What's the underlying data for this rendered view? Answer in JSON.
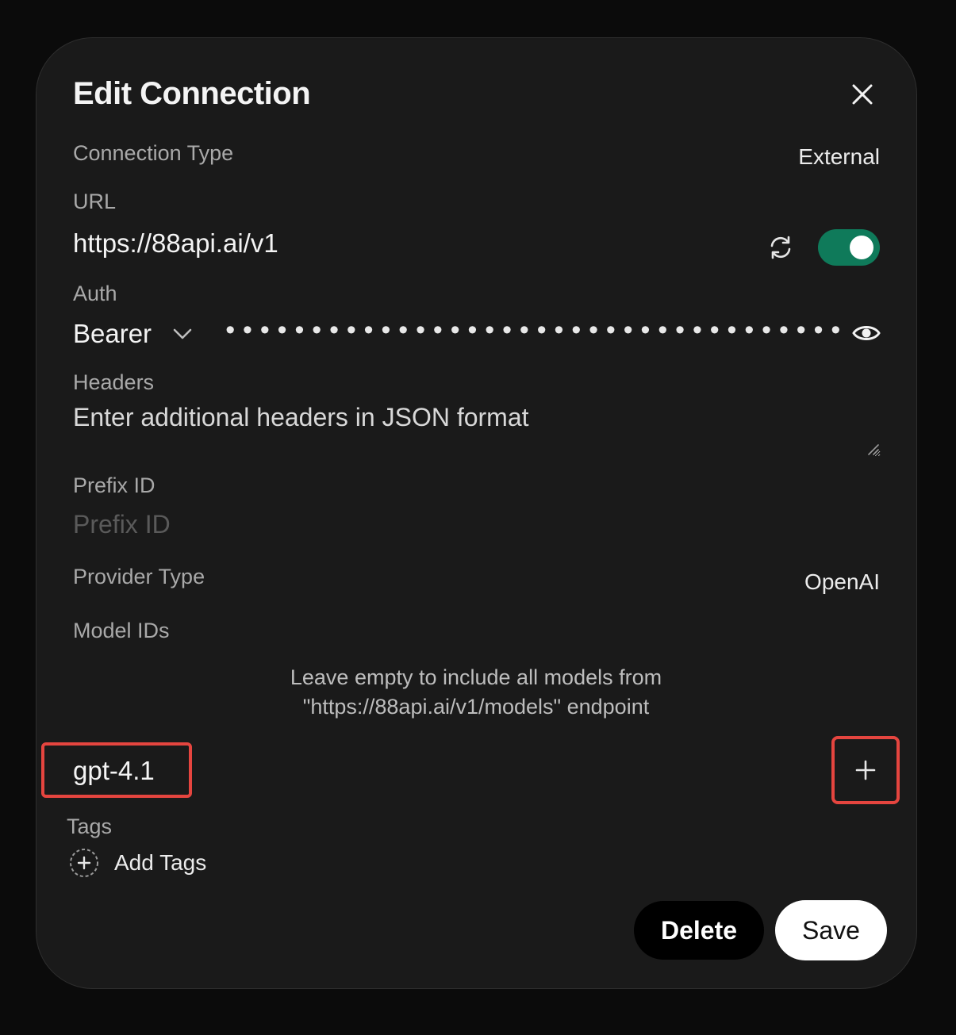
{
  "dialog": {
    "title": "Edit Connection"
  },
  "connection_type": {
    "label": "Connection Type",
    "value": "External"
  },
  "url": {
    "label": "URL",
    "value": "https://88api.ai/v1",
    "enabled": true
  },
  "auth": {
    "label": "Auth",
    "type": "Bearer",
    "key_masked": "••••••••••••••••••••••••••••••••••••••••••"
  },
  "headers": {
    "label": "Headers",
    "placeholder": "Enter additional headers in JSON format"
  },
  "prefix_id": {
    "label": "Prefix ID",
    "placeholder": "Prefix ID"
  },
  "provider_type": {
    "label": "Provider Type",
    "value": "OpenAI"
  },
  "model_ids": {
    "label": "Model IDs",
    "hint_line1": "Leave empty to include all models from",
    "hint_line2": "\"https://88api.ai/v1/models\" endpoint",
    "input_value": "gpt-4.1"
  },
  "tags": {
    "label": "Tags",
    "add_label": "Add Tags"
  },
  "actions": {
    "delete_label": "Delete",
    "save_label": "Save"
  },
  "colors": {
    "background": "#0b0b0b",
    "dialog": "#1a1a1a",
    "toggle_on": "#0f7a5a",
    "highlight": "#e5453f"
  },
  "icons": {
    "close": "close-icon",
    "refresh": "refresh-icon",
    "chevron": "chevron-down-icon",
    "visibility": "eye-icon",
    "add": "plus-icon",
    "add_tag": "plus-circle-icon"
  }
}
